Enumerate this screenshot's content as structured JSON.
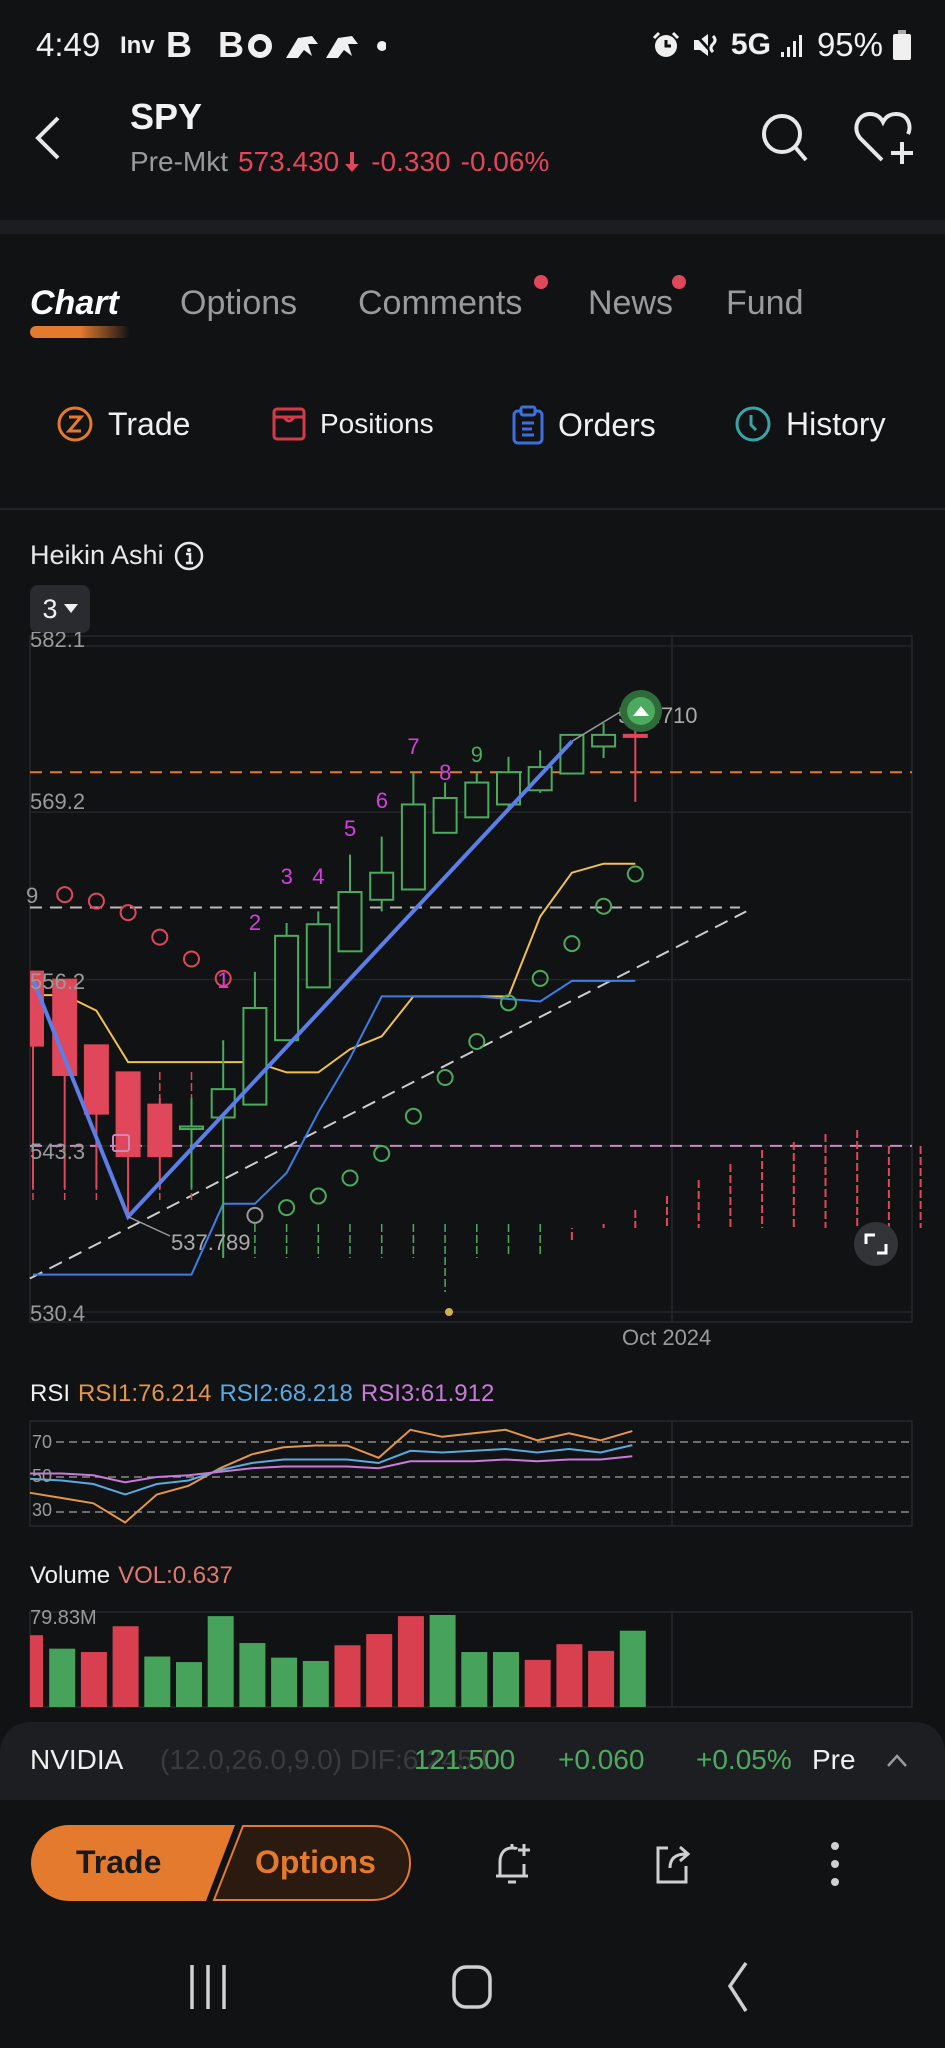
{
  "status_bar": {
    "time": "4:49",
    "app_icons": [
      "inv-icon",
      "b-icon",
      "b-icon",
      "c-icon",
      "bird-icon",
      "bird-icon",
      "dot-icon"
    ],
    "app_label": "Inv",
    "app_letters": "B B",
    "network": "5G",
    "battery": "95%"
  },
  "header": {
    "ticker": "SPY",
    "session_label": "Pre-Mkt",
    "price": "573.430",
    "change": "-0.330",
    "change_pct": "-0.06%",
    "direction": "down",
    "down_color": "#e0475a"
  },
  "tabs": [
    {
      "label": "Chart",
      "active": true,
      "badge": false
    },
    {
      "label": "Options",
      "active": false,
      "badge": false
    },
    {
      "label": "Comments",
      "active": false,
      "badge": true
    },
    {
      "label": "News",
      "active": false,
      "badge": true
    },
    {
      "label": "Fund",
      "active": false,
      "badge": false
    }
  ],
  "actions": [
    {
      "label": "Trade",
      "icon": "trade-icon",
      "color": "#e37a2e"
    },
    {
      "label": "Positions",
      "icon": "positions-icon",
      "color": "#d63a4a"
    },
    {
      "label": "Orders",
      "icon": "orders-icon",
      "color": "#3d6fe0"
    },
    {
      "label": "History",
      "icon": "history-icon",
      "color": "#3aa3a8"
    }
  ],
  "chart": {
    "type_label": "Heikin Ashi",
    "period": "3",
    "y_ticks": [
      "582.1",
      "569.2",
      "556.2",
      "543.3",
      "530.4"
    ],
    "x_label": "Oct 2024",
    "high_marker": "574.710",
    "low_marker": "537.789",
    "left_edge_label": "9"
  },
  "chart_data": [
    {
      "type": "candlestick",
      "title": "Heikin Ashi",
      "ylim": [
        530.4,
        582.1
      ],
      "y_ticks": [
        582.1,
        569.2,
        556.2,
        543.3,
        530.4
      ],
      "x_tick": "Oct 2024",
      "candles": [
        {
          "o": 556.9,
          "c": 551.0,
          "h": 556.9,
          "l": 540.0,
          "dir": "down"
        },
        {
          "o": 556.2,
          "c": 548.8,
          "h": 556.2,
          "l": 540.0,
          "dir": "down"
        },
        {
          "o": 551.1,
          "c": 545.8,
          "h": 551.1,
          "l": 540.0,
          "dir": "down"
        },
        {
          "o": 549.0,
          "c": 542.5,
          "h": 549.0,
          "l": 537.8,
          "dir": "down"
        },
        {
          "o": 546.5,
          "c": 542.5,
          "h": 547.0,
          "l": 540.0,
          "dir": "down"
        },
        {
          "o": 544.8,
          "c": 544.6,
          "h": 547.0,
          "l": 540.0,
          "dir": "up"
        },
        {
          "o": 545.5,
          "c": 547.7,
          "h": 551.5,
          "l": 534.6,
          "dir": "up"
        },
        {
          "o": 546.5,
          "c": 554.0,
          "h": 556.8,
          "l": 546.5,
          "dir": "up"
        },
        {
          "o": 551.5,
          "c": 559.6,
          "h": 560.6,
          "l": 551.5,
          "dir": "up"
        },
        {
          "o": 555.6,
          "c": 560.5,
          "h": 561.5,
          "l": 555.6,
          "dir": "up"
        },
        {
          "o": 558.4,
          "c": 563.0,
          "h": 565.9,
          "l": 558.4,
          "dir": "up"
        },
        {
          "o": 562.4,
          "c": 564.5,
          "h": 567.3,
          "l": 561.5,
          "dir": "up"
        },
        {
          "o": 563.2,
          "c": 569.8,
          "h": 572.3,
          "l": 563.2,
          "dir": "up"
        },
        {
          "o": 567.6,
          "c": 570.3,
          "h": 571.5,
          "l": 567.6,
          "dir": "up"
        },
        {
          "o": 568.8,
          "c": 571.5,
          "h": 572.3,
          "l": 568.8,
          "dir": "up"
        },
        {
          "o": 569.8,
          "c": 572.3,
          "h": 573.5,
          "l": 569.6,
          "dir": "up"
        },
        {
          "o": 570.9,
          "c": 572.7,
          "h": 574.0,
          "l": 570.7,
          "dir": "up"
        },
        {
          "o": 572.2,
          "c": 575.2,
          "h": 574.7,
          "l": 572.2,
          "dir": "up"
        },
        {
          "o": 574.3,
          "c": 575.2,
          "h": 576.1,
          "l": 573.4,
          "dir": "up"
        },
        {
          "o": 575.2,
          "c": 575.2,
          "h": 577.0,
          "l": 570.0,
          "dir": "down"
        }
      ],
      "td_sequential": [
        {
          "index": 6,
          "label": "1",
          "color": "#d63ee0"
        },
        {
          "index": 7,
          "label": "2",
          "color": "#d63ee0"
        },
        {
          "index": 8,
          "label": "3",
          "color": "#d63ee0"
        },
        {
          "index": 9,
          "label": "4",
          "color": "#d63ee0"
        },
        {
          "index": 10,
          "label": "5",
          "color": "#d63ee0"
        },
        {
          "index": 11,
          "label": "6",
          "color": "#d63ee0"
        },
        {
          "index": 12,
          "label": "7",
          "color": "#d63ee0"
        },
        {
          "index": 13,
          "label": "8",
          "color": "#d63ee0"
        },
        {
          "index": 14,
          "label": "9",
          "color": "#4caa5e"
        }
      ],
      "sar": [
        {
          "index": 1,
          "v": 562.8,
          "color": "#e0475a"
        },
        {
          "index": 2,
          "v": 562.3,
          "color": "#e0475a"
        },
        {
          "index": 3,
          "v": 561.4,
          "color": "#e0475a"
        },
        {
          "index": 4,
          "v": 559.5,
          "color": "#e0475a"
        },
        {
          "index": 5,
          "v": 557.8,
          "color": "#e0475a"
        },
        {
          "index": 6,
          "v": 556.3,
          "color": "#e0475a"
        },
        {
          "index": 7,
          "v": 537.9,
          "color": "#9a9a9a"
        },
        {
          "index": 8,
          "v": 538.5,
          "color": "#4caa5e"
        },
        {
          "index": 9,
          "v": 539.4,
          "color": "#4caa5e"
        },
        {
          "index": 10,
          "v": 540.8,
          "color": "#4caa5e"
        },
        {
          "index": 11,
          "v": 542.7,
          "color": "#4caa5e"
        },
        {
          "index": 12,
          "v": 545.6,
          "color": "#4caa5e"
        },
        {
          "index": 13,
          "v": 548.6,
          "color": "#4caa5e"
        },
        {
          "index": 14,
          "v": 551.4,
          "color": "#4caa5e"
        },
        {
          "index": 15,
          "v": 554.4,
          "color": "#4caa5e"
        },
        {
          "index": 16,
          "v": 556.3,
          "color": "#4caa5e"
        },
        {
          "index": 17,
          "v": 559.0,
          "color": "#4caa5e"
        },
        {
          "index": 18,
          "v": 561.9,
          "color": "#4caa5e"
        },
        {
          "index": 19,
          "v": 564.4,
          "color": "#4caa5e"
        }
      ],
      "yellow_line": [
        555.0,
        555.0,
        553.8,
        549.8,
        549.8,
        549.8,
        549.8,
        549.8,
        549.0,
        549.0,
        550.8,
        551.8,
        554.9,
        554.9,
        554.9,
        554.9,
        561.1,
        564.5,
        565.2,
        565.2
      ],
      "blue_line": [
        533.3,
        533.3,
        533.3,
        533.3,
        533.3,
        533.3,
        538.8,
        538.8,
        541.2,
        545.9,
        550.1,
        554.9,
        554.9,
        554.9,
        554.9,
        554.7,
        554.5,
        556.1,
        556.1,
        556.1
      ],
      "zigzag": [
        {
          "index": 0,
          "v": 556.2
        },
        {
          "index": 3,
          "v": 537.8
        },
        {
          "index": 17,
          "v": 574.7
        }
      ],
      "levels": [
        {
          "v": 572.3,
          "color": "#e37a2e",
          "style": "dashed"
        },
        {
          "v": 561.8,
          "color": "#bbbbbb",
          "style": "dashed"
        },
        {
          "v": 543.3,
          "color": "#c98bbd",
          "style": "dashed"
        }
      ],
      "trendline": {
        "from": {
          "index": -0.1,
          "v": 533.0
        },
        "to": {
          "index": 22.5,
          "v": 561.5
        }
      }
    },
    {
      "type": "line",
      "title": "RSI",
      "ylim": [
        22,
        82
      ],
      "ref_lines": [
        70,
        50,
        30
      ],
      "series": [
        {
          "name": "RSI1",
          "value_label": "76.214",
          "color": "#e3954b",
          "values": [
            41,
            38,
            35,
            24,
            40,
            45,
            55,
            63,
            67,
            68,
            68,
            61,
            77,
            73,
            75,
            77,
            71,
            75,
            71,
            76.2
          ]
        },
        {
          "name": "RSI2",
          "value_label": "68.218",
          "color": "#5aa9e0",
          "values": [
            49,
            48,
            46,
            40,
            46,
            48,
            54,
            58,
            60,
            60,
            60,
            58,
            65,
            64,
            65,
            66,
            64,
            66,
            64,
            68.2
          ]
        },
        {
          "name": "RSI3",
          "value_label": "61.912",
          "color": "#c77bd8",
          "values": [
            52,
            52,
            51,
            47,
            50,
            51,
            53,
            55,
            56,
            56,
            56,
            55,
            59,
            59,
            59,
            60,
            59,
            60,
            60,
            61.9
          ]
        }
      ]
    },
    {
      "type": "bar",
      "title": "Volume",
      "value_label": "VOL:0.637",
      "max_label": "79.83M",
      "ylim": [
        0,
        82
      ],
      "values": [
        64,
        52,
        49,
        72,
        45,
        40,
        81,
        57,
        44,
        41,
        55,
        65,
        81,
        82,
        49,
        49,
        42,
        56,
        50,
        68
      ],
      "colors": [
        "down",
        "up",
        "down",
        "down",
        "up",
        "up",
        "up",
        "up",
        "up",
        "up",
        "down",
        "down",
        "down",
        "up",
        "up",
        "up",
        "down",
        "down",
        "down",
        "up"
      ],
      "up_color": "#47a35c",
      "down_color": "#d8404f"
    }
  ],
  "indicators": {
    "rsi_label": "RSI",
    "rsi1": "RSI1:76.214",
    "rsi2": "RSI2:68.218",
    "rsi3": "RSI3:61.912",
    "rsi_ticks": [
      "70",
      "50",
      "30"
    ],
    "volume_label": "Volume",
    "vol_value": "VOL:0.637",
    "vol_max": "79.83M"
  },
  "mini_quote": {
    "name": "NVIDIA",
    "ghost_text": "(12.0,26.0,9.0) DIF:6.245 D",
    "price": "121.500",
    "change": "+0.060",
    "change_pct": "+0.05%",
    "session": "Pre"
  },
  "bottom_bar": {
    "trade_label": "Trade",
    "options_label": "Options"
  }
}
